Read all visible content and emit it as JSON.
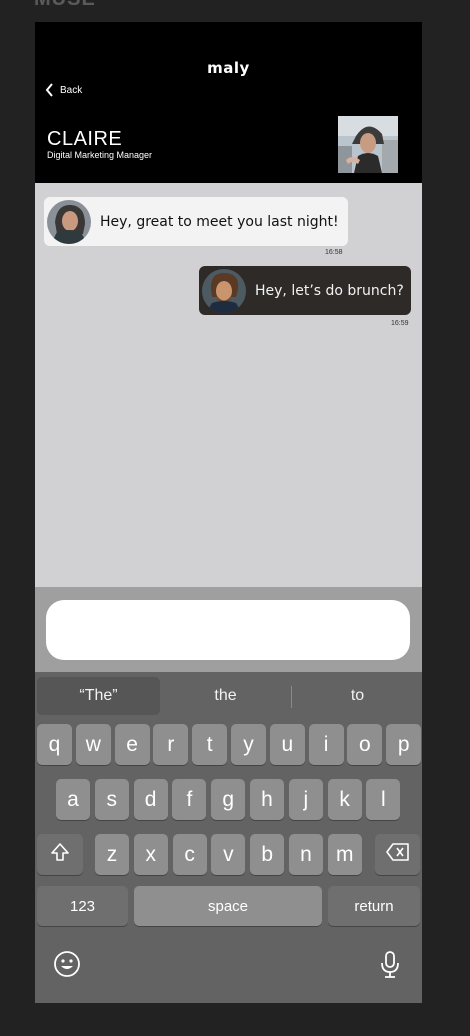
{
  "frame_label": "MUSE",
  "header": {
    "app_title": "maly",
    "back_label": "Back",
    "contact_name": "CLAIRE",
    "contact_role": "Digital Marketing Manager"
  },
  "messages": [
    {
      "direction": "incoming",
      "text": "Hey, great to meet you last night!",
      "time": "16:58"
    },
    {
      "direction": "outgoing",
      "text": "Hey, let’s do brunch?",
      "time": "16:59"
    }
  ],
  "input": {
    "value": "",
    "placeholder": ""
  },
  "keyboard": {
    "suggestions": [
      "“The”",
      "the",
      "to"
    ],
    "row1": [
      "q",
      "w",
      "e",
      "r",
      "t",
      "y",
      "u",
      "i",
      "o",
      "p"
    ],
    "row2": [
      "a",
      "s",
      "d",
      "f",
      "g",
      "h",
      "j",
      "k",
      "l"
    ],
    "row3": [
      "z",
      "x",
      "c",
      "v",
      "b",
      "n",
      "m"
    ],
    "numbers_label": "123",
    "space_label": "space",
    "return_label": "return",
    "shift_icon": "shift-icon",
    "delete_icon": "delete-icon",
    "emoji_icon": "emoji-icon",
    "mic_icon": "microphone-icon"
  },
  "colors": {
    "header_bg": "#000000",
    "chat_bg": "#d1d1d4",
    "incoming_bubble": "#f3f3f4",
    "outgoing_bubble": "#2d2a28",
    "keyboard_bg": "#636363",
    "key_bg": "#8f8f8f"
  }
}
